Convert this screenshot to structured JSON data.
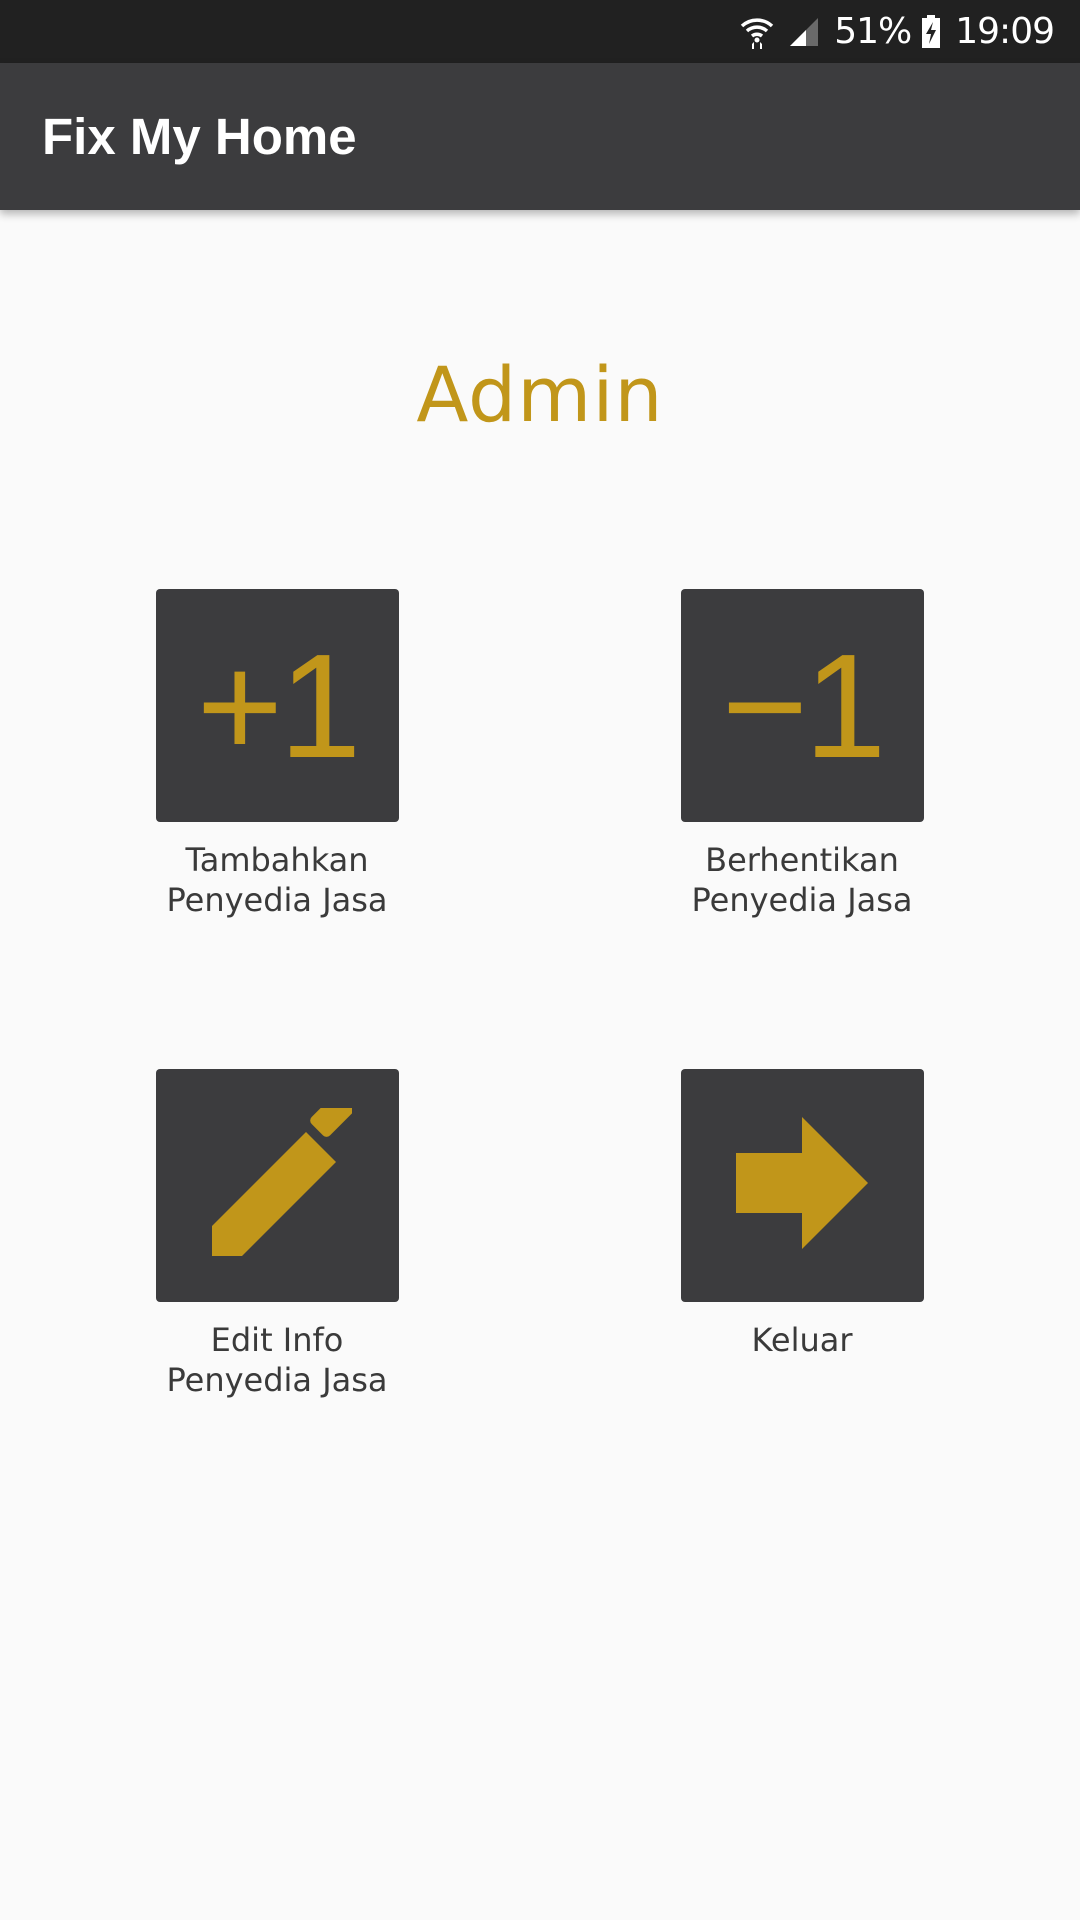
{
  "status_bar": {
    "battery_percent": "51%",
    "time": "19:09",
    "icons": [
      "wifi-icon",
      "cell-signal-icon",
      "battery-charging-icon"
    ]
  },
  "app_bar": {
    "title": "Fix My Home"
  },
  "header": {
    "title": "Admin"
  },
  "menu": {
    "items": [
      {
        "icon": "plus-one-icon",
        "glyph": "+1",
        "label_lines": [
          "Tambahkan",
          "Penyedia Jasa"
        ]
      },
      {
        "icon": "minus-one-icon",
        "glyph": "−1",
        "label_lines": [
          "Berhentikan",
          "Penyedia Jasa"
        ]
      },
      {
        "icon": "pencil-icon",
        "label_lines": [
          "Edit Info",
          "Penyedia Jasa"
        ]
      },
      {
        "icon": "arrow-right-icon",
        "label_lines": [
          "Keluar"
        ]
      }
    ]
  },
  "colors": {
    "accent": "#c1961a",
    "app_bar": "#3c3c3e",
    "status_bar": "#212121",
    "background": "#fafafa",
    "label_text": "#3a3a3a"
  }
}
